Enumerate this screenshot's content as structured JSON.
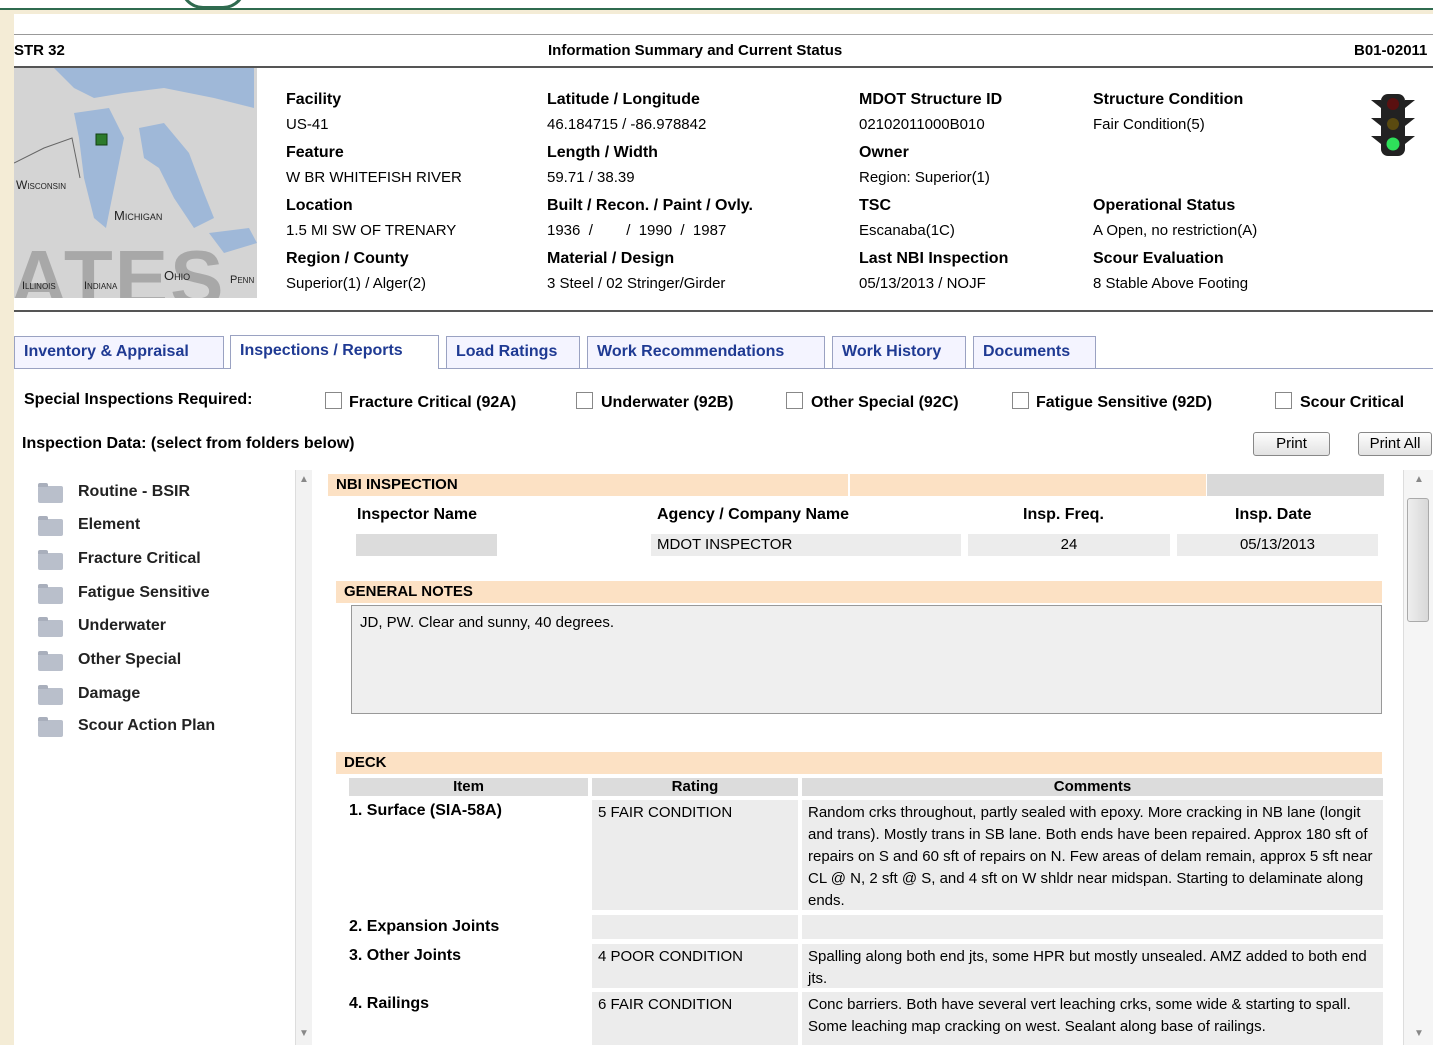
{
  "header": {
    "left": "STR 32",
    "center": "Information Summary and Current Status",
    "right": "B01-02011"
  },
  "map": {
    "labels": [
      "Wisconsin",
      "Michigan",
      "Illinois",
      "Indiana",
      "Ohio",
      "Penn"
    ],
    "big_text": "ATES"
  },
  "summary": {
    "facility_label": "Facility",
    "facility_value": "US-41",
    "feature_label": "Feature",
    "feature_value": "W BR WHITEFISH RIVER",
    "location_label": "Location",
    "location_value": "1.5 MI SW OF TRENARY",
    "region_label": "Region  /  County",
    "region_value": "Superior(1)  /  Alger(2)",
    "latlon_label": "Latitude  /  Longitude",
    "latlon_value": "46.184715  /   -86.978842",
    "lenwid_label": "Length  /  Width",
    "lenwid_value": "59.71  /  38.39",
    "built_label": "Built / Recon. / Paint / Ovly.",
    "built_value": "1936  /        /  1990  /  1987",
    "material_label": "Material  /  Design",
    "material_value": "3 Steel  /   02 Stringer/Girder",
    "structid_label": "MDOT Structure ID",
    "structid_value": "02102011000B010",
    "owner_label": "Owner",
    "owner_value": "Region: Superior(1)",
    "tsc_label": "TSC",
    "tsc_value": "Escanaba(1C)",
    "lastnbi_label": "Last NBI Inspection",
    "lastnbi_value": "05/13/2013   /   NOJF",
    "condition_label": "Structure Condition",
    "condition_value": "Fair Condition(5)",
    "opstatus_label": "Operational Status",
    "opstatus_value": "A Open, no restriction(A)",
    "scour_label": "Scour Evaluation",
    "scour_value": "8 Stable Above Footing"
  },
  "tabs": [
    {
      "label": "Inventory & Appraisal"
    },
    {
      "label": "Inspections / Reports"
    },
    {
      "label": "Load Ratings"
    },
    {
      "label": "Work Recommendations"
    },
    {
      "label": "Work History"
    },
    {
      "label": "Documents"
    }
  ],
  "special": {
    "label": "Special Inspections Required:",
    "options": [
      {
        "label": "Fracture Critical (92A)",
        "checked": false
      },
      {
        "label": "Underwater (92B)",
        "checked": false
      },
      {
        "label": "Other Special (92C)",
        "checked": false
      },
      {
        "label": "Fatigue Sensitive (92D)",
        "checked": false
      },
      {
        "label": "Scour Critical",
        "checked": false
      }
    ]
  },
  "inspection_data_label": "Inspection Data: (select from folders below)",
  "buttons": {
    "print": "Print",
    "print_all": "Print All"
  },
  "folders": [
    {
      "label": "Routine -  BSIR"
    },
    {
      "label": "Element"
    },
    {
      "label": "Fracture Critical"
    },
    {
      "label": "Fatigue Sensitive"
    },
    {
      "label": "Underwater"
    },
    {
      "label": "Other Special"
    },
    {
      "label": "Damage"
    },
    {
      "label": "Scour Action Plan"
    }
  ],
  "nbi": {
    "title": "NBI INSPECTION",
    "headers": [
      "Inspector Name",
      "Agency / Company Name",
      "Insp. Freq.",
      "Insp. Date"
    ],
    "inspector": "",
    "agency": "MDOT INSPECTOR",
    "freq": "24",
    "date": "05/13/2013"
  },
  "general_notes": {
    "title": "GENERAL NOTES",
    "text": "JD, PW. Clear and sunny, 40 degrees."
  },
  "deck": {
    "title": "DECK",
    "headers": [
      "Item",
      "Rating",
      "Comments"
    ],
    "rows": [
      {
        "item": "1. Surface (SIA-58A)",
        "rating": "5 FAIR CONDITION",
        "comment": "Random crks throughout, partly sealed with epoxy. More cracking in NB lane (longit and trans). Mostly trans in SB lane. Both ends have been repaired. Approx 180 sft of repairs on S and 60 sft of repairs on N. Few areas of delam remain, approx 5 sft near CL @ N, 2 sft @ S, and 4 sft on W shldr near midspan. Starting to delaminate along ends."
      },
      {
        "item": "2. Expansion Joints",
        "rating": "",
        "comment": ""
      },
      {
        "item": "3. Other Joints",
        "rating": "4 POOR CONDITION",
        "comment": "Spalling along both end jts, some HPR but mostly unsealed. AMZ added to both end jts."
      },
      {
        "item": "4. Railings",
        "rating": "6 FAIR CONDITION",
        "comment": "Conc barriers. Both have several vert leaching crks, some wide & starting to spall. Some leaching map cracking on west. Sealant along base of railings."
      }
    ]
  },
  "colors": {
    "tab_text": "#1f3a93",
    "section_header": "#fce1c4",
    "accent_green": "#2f6b4f"
  }
}
